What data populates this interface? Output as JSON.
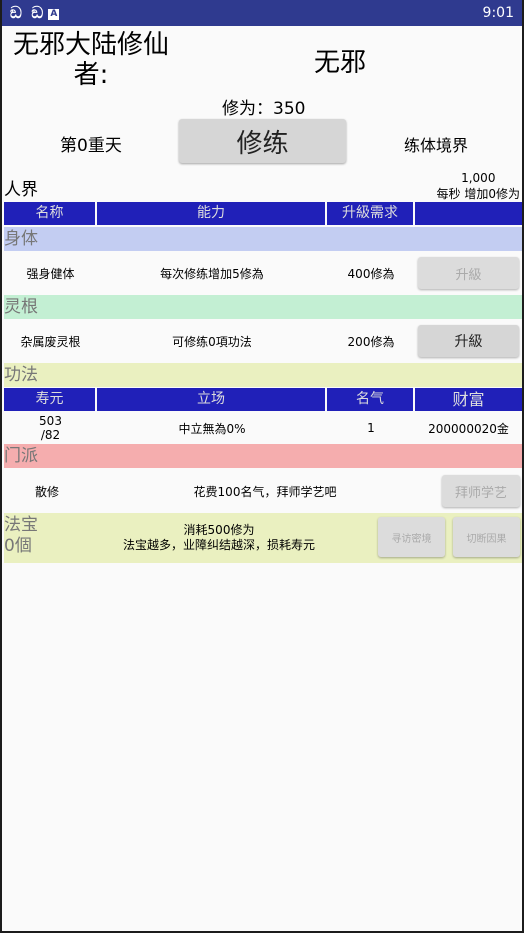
{
  "status_bar": {
    "left_icons": "ඞ ඞ",
    "notif_icon": "A",
    "time": "9:01"
  },
  "header": {
    "user_label": "无邪大陆修仙者:",
    "user_name": "无邪",
    "cultivation": "修为：350",
    "day": "第0重天",
    "cultivate_button": "修练",
    "realm": "练体境界"
  },
  "world": {
    "name": "人界",
    "rate_value": "1,000",
    "rate_text": "每秒 增加0修为"
  },
  "table1": {
    "headers": [
      "名称",
      "能力",
      "升級需求",
      ""
    ]
  },
  "sections": {
    "body": {
      "title": "身体",
      "row": {
        "name": "强身健体",
        "ability": "每次修练增加5修為",
        "requirement": "400修為",
        "button": "升級"
      }
    },
    "root": {
      "title": "灵根",
      "row": {
        "name": "杂属废灵根",
        "ability": "可修练0項功法",
        "requirement": "200修為",
        "button": "升級"
      }
    },
    "skill": {
      "title": "功法",
      "headers": [
        "寿元",
        "立场",
        "名气",
        "财富"
      ],
      "row": {
        "life": "503\n/82",
        "stance": "中立無為0%",
        "fame": "1",
        "wealth": "200000020金"
      }
    },
    "sect": {
      "title": "门派",
      "row": {
        "name": "散修",
        "desc": "花费100名气，拜师学艺吧",
        "button": "拜师学艺"
      }
    },
    "treasure": {
      "title": "法宝",
      "count": "0個",
      "cost": "消耗500修为",
      "desc": "法宝越多，业障纠结越深，损耗寿元",
      "btn_seek": "寻访密境",
      "btn_cut": "切断因果"
    }
  },
  "colors": {
    "status_bar": "#2f3a8f",
    "table_header": "#2020b8",
    "body_section": "#c3cdf2",
    "root_section": "#c3efd3",
    "skill_section": "#eaf0c0",
    "sect_section": "#f5adae",
    "treasure_section": "#eaf0c0"
  }
}
